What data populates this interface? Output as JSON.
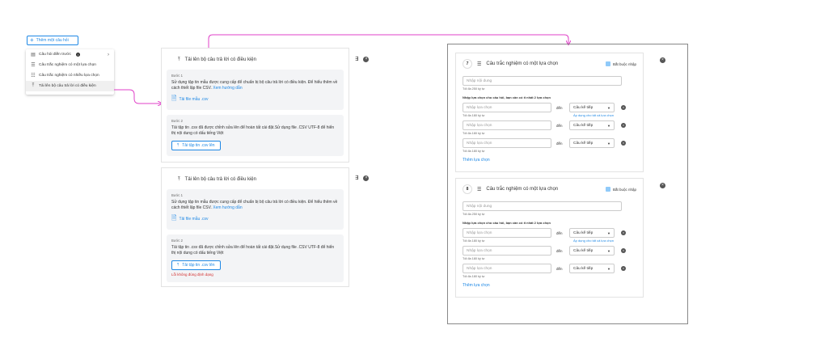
{
  "add_question": {
    "label": "Thêm một câu hỏi"
  },
  "menu": {
    "items": [
      {
        "label": "Câu hỏi điền trước",
        "icon": "document-icon"
      },
      {
        "label": "Câu trắc nghiệm có một lựa chọn",
        "icon": "list-icon"
      },
      {
        "label": "Câu trắc nghiệm có nhiều lựa chọn",
        "icon": "list-check-icon"
      },
      {
        "label": "Tải lên bộ câu trả lời có điều kiện",
        "icon": "upload-icon"
      }
    ]
  },
  "upload_cards": [
    {
      "title": "Tải lên bộ câu trả lời có điều kiện",
      "step1_label": "Bước 1",
      "step1_text": "Sử dụng tập tin mẫu được cung cấp để chuẩn bị bộ câu trả lời có điều kiện. Để hiểu thêm về cách thiết lập file CSV.",
      "step1_link": "Xem hướng dẫn",
      "sample_file": "Tải file mẫu .csv",
      "step2_label": "Bước 2",
      "step2_text": "Tải tập tin .csv đã được chỉnh sửa lên để hoàn tất cài đặt.Sử dụng file .CSV UTF-8 để hiển thị nội dung có dấu tiếng Việt",
      "upload_btn": "Tải tập tin .csv lên",
      "error": ""
    },
    {
      "title": "Tải lên bộ câu trả lời có điều kiện",
      "step1_label": "Bước 1",
      "step1_text": "Sử dụng tập tin mẫu được cung cấp để chuẩn bị bộ câu trả lời có điều kiện. Để hiểu thêm về cách thiết lập file CSV.",
      "step1_link": "Xem hướng dẫn",
      "sample_file": "Tải file mẫu .csv",
      "step2_label": "Bước 2",
      "step2_text": "Tải tập tin .csv đã được chỉnh sửa lên để hoàn tất cài đặt.Sử dụng file .CSV UTF-8 để hiển thị nội dung có dấu tiếng Việt",
      "upload_btn": "Tải tập tin .csv lên",
      "error": "Lỗi không đúng định dạng"
    }
  ],
  "questions": [
    {
      "number": "7",
      "title": "Câu trắc nghiệm có một lựa chọn",
      "required_label": "Bắt buộc nhập",
      "content_placeholder": "Nhập nội dung",
      "content_hint": "Tối đa 250 ký tự",
      "options_hint": "Nhập lựa chọn cho câu hỏi, bạn cần có ít nhất 2 lựa chọn",
      "options": [
        {
          "placeholder": "Nhập lựa chọn",
          "den": "đến",
          "select": "Câu kế tiếp",
          "hint": "Tối đa 180 ký tự",
          "apply": "Áp dụng cho tất cả lựa chọn"
        },
        {
          "placeholder": "Nhập lựa chọn",
          "den": "đến",
          "select": "Câu kế tiếp",
          "hint": "Tối đa 180 ký tự",
          "apply": ""
        },
        {
          "placeholder": "Nhập lựa chọn",
          "den": "đến",
          "select": "Câu kế tiếp",
          "hint": "Tối đa 180 ký tự",
          "apply": ""
        }
      ],
      "add_option": "Thêm lựa chọn"
    },
    {
      "number": "8",
      "title": "Câu trắc nghiệm có một lựa chọn",
      "required_label": "Bắt buộc nhập",
      "content_placeholder": "Nhập nội dung",
      "content_hint": "Tối đa 250 ký tự",
      "options_hint": "Nhập lựa chọn cho câu hỏi, bạn cần có ít nhất 2 lựa chọn",
      "options": [
        {
          "placeholder": "Nhập lựa chọn",
          "den": "đến",
          "select": "Câu kế tiếp",
          "hint": "Tối đa 180 ký tự",
          "apply": "Áp dụng cho tất cả lựa chọn"
        },
        {
          "placeholder": "Nhập lựa chọn",
          "den": "đến",
          "select": "Câu kế tiếp",
          "hint": "Tối đa 180 ký tự",
          "apply": ""
        },
        {
          "placeholder": "Nhập lựa chọn",
          "den": "đến",
          "select": "Câu kế tiếp",
          "hint": "Tối đa 180 ký tự",
          "apply": ""
        }
      ],
      "add_option": "Thêm lựa chọn"
    }
  ],
  "colors": {
    "accent": "#1e88e5",
    "arrow": "#e040c8",
    "error": "#d32f2f"
  }
}
